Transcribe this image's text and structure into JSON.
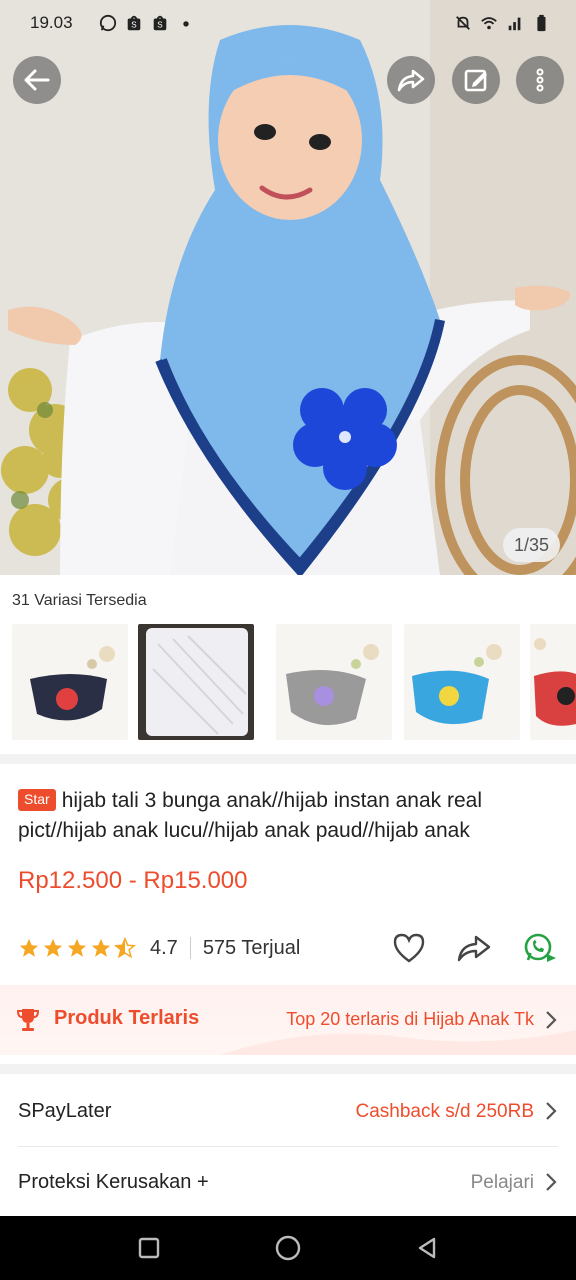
{
  "status_bar": {
    "time": "19.03",
    "left_icons": [
      "whatsapp-icon",
      "shopee-icon",
      "shopee-icon",
      "dot-icon"
    ],
    "right_icons": [
      "mute-icon",
      "wifi-icon",
      "signal-icon",
      "battery-icon"
    ]
  },
  "top_actions": {
    "back_icon": "arrow-left-icon",
    "share_icon": "share-icon",
    "edit_icon": "edit-icon",
    "more_icon": "more-vertical-icon"
  },
  "gallery": {
    "counter": "1/35",
    "current": 1,
    "total": 35
  },
  "variations": {
    "title": "31 Variasi Tersedia",
    "thumbnails": [
      {
        "name": "navy hijab with red flower",
        "color": "#2a2f45",
        "accent": "#e04040"
      },
      {
        "name": "white hijab in plastic",
        "color": "#efeff3",
        "accent": "#ffffff"
      },
      {
        "name": "grey hijab with purple flower",
        "color": "#9a9a9a",
        "accent": "#a890e0"
      },
      {
        "name": "blue hijab with yellow flower",
        "color": "#3aa6e0",
        "accent": "#f2d640"
      },
      {
        "name": "red hijab",
        "color": "#d94040",
        "accent": "#222222"
      }
    ]
  },
  "product": {
    "badge": "Star",
    "title": "hijab tali 3 bunga anak//hijab instan anak real pict//hijab anak lucu//hijab anak paud//hijab anak",
    "price": "Rp12.500 - Rp15.000",
    "rating": "4.7",
    "rating_value": 4.7,
    "sold": "575 Terjual"
  },
  "best_seller": {
    "label": "Produk Terlaris",
    "detail": "Top 20 terlaris di Hijab Anak Tk"
  },
  "rows": [
    {
      "label": "SPayLater",
      "value": "Cashback s/d 250RB",
      "value_color": "#ee4d2d"
    },
    {
      "label": "Proteksi Kerusakan +",
      "value": "Pelajari",
      "value_color": "#888888"
    }
  ],
  "colors": {
    "accent": "#ee4d2d",
    "whatsapp": "#25a244"
  }
}
